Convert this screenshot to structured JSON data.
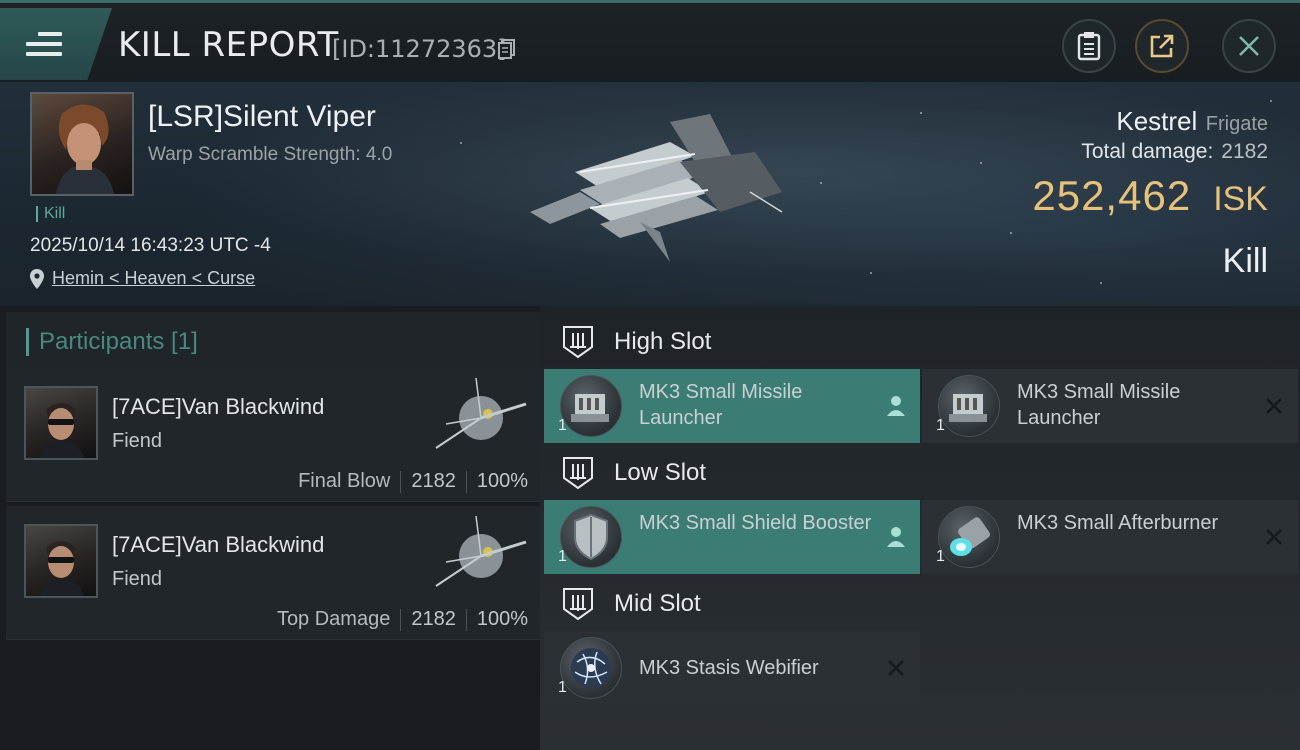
{
  "header": {
    "title": "KILL REPORT",
    "report_id": "[ID:11272363]",
    "icons": [
      "menu-icon",
      "copy-icon",
      "clipboard-icon",
      "share-icon",
      "close-icon"
    ]
  },
  "victim": {
    "name": "[LSR]Silent Viper",
    "scramble": "Warp Scramble Strength: 4.0",
    "tag": "Kill",
    "timestamp": "2025/10/14 16:43:23 UTC -4",
    "location": "Hemin < Heaven < Curse",
    "ship_name": "Kestrel",
    "ship_class": "Frigate",
    "total_damage_label": "Total damage:",
    "total_damage": "2182",
    "isk_value": "252,462",
    "isk_unit": "ISK",
    "result": "Kill"
  },
  "participants": {
    "title": "Participants [1]",
    "rows": [
      {
        "name": "[7ACE]Van Blackwind",
        "ship": "Fiend",
        "label": "Final Blow",
        "damage": "2182",
        "percent": "100%"
      },
      {
        "name": "[7ACE]Van Blackwind",
        "ship": "Fiend",
        "label": "Top Damage",
        "damage": "2182",
        "percent": "100%"
      }
    ]
  },
  "slots": {
    "high": {
      "title": "High Slot",
      "modules": [
        {
          "name": "MK3 Small Missile Launcher",
          "qty": "1",
          "status": "destroyed-by-attacker",
          "active": true
        },
        {
          "name": "MK3 Small Missile Launcher",
          "qty": "1",
          "status": "destroyed",
          "active": false
        }
      ]
    },
    "low": {
      "title": "Low Slot",
      "modules": [
        {
          "name": "MK3 Small Shield Booster",
          "qty": "1",
          "status": "destroyed-by-attacker",
          "active": true
        },
        {
          "name": "MK3 Small Afterburner",
          "qty": "1",
          "status": "destroyed",
          "active": false
        }
      ]
    },
    "mid": {
      "title": "Mid Slot",
      "modules": [
        {
          "name": "MK3 Stasis Webifier",
          "qty": "1",
          "status": "destroyed",
          "active": false
        }
      ]
    }
  },
  "colors": {
    "accent": "#3b7c74",
    "isk": "#e7c27c",
    "participants_title": "#49897f"
  }
}
